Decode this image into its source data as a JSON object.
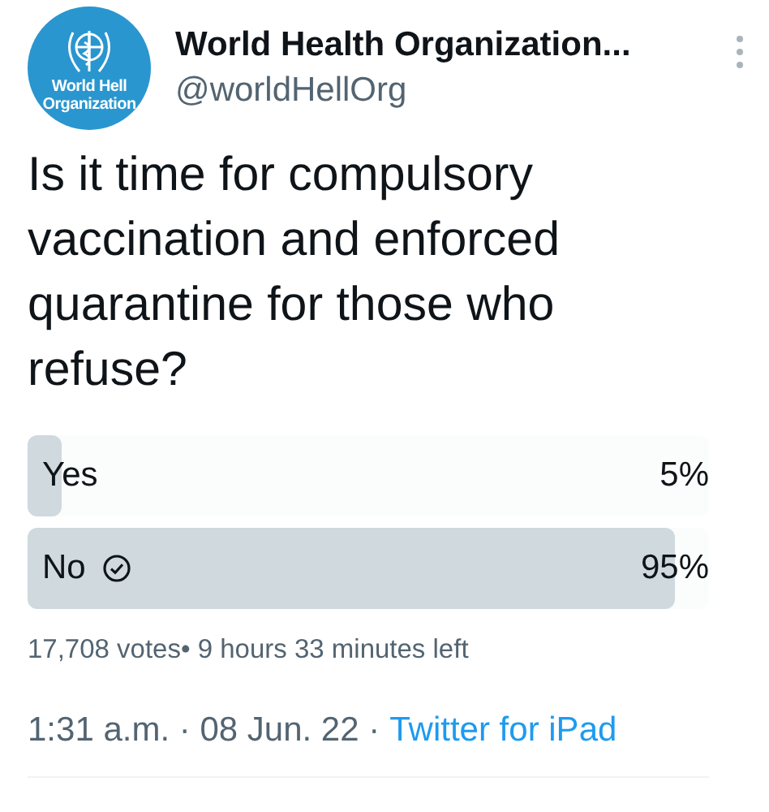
{
  "author": {
    "avatar_text": [
      "World Hell",
      "Organization"
    ],
    "name": "World Health Organization...",
    "handle": "@worldHellOrg"
  },
  "question": "Is it time for compulsory vaccination and enforced quarantine for those who refuse?",
  "poll": {
    "options": [
      {
        "label": "Yes",
        "percent": "5%",
        "level": 0.05,
        "selected": false
      },
      {
        "label": "No",
        "percent": "95%",
        "level": 0.95,
        "selected": true
      }
    ],
    "summary": "17,708 votes• 9 hours 33 minutes left"
  },
  "meta": {
    "time": "1:31 a.m. · 08 Jun. 22 ·",
    "source": "Twitter for iPad"
  }
}
